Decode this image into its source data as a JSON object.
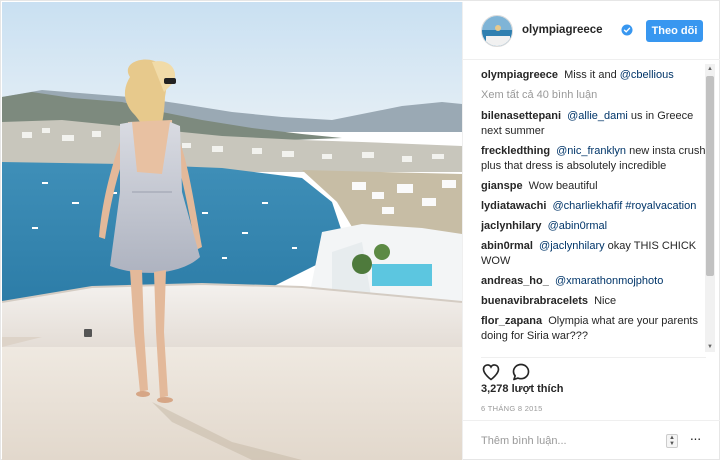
{
  "post": {
    "username": "olympiagreece",
    "follow_label": "Theo dõi",
    "view_all_label": "Xem tất cả 40 bình luận",
    "comments": [
      {
        "user": "olympiagreece",
        "text": "Miss it and ",
        "mention": "@cbellious",
        "after": ""
      },
      {
        "user": "bilenasettepani",
        "text": "",
        "mention": "@allie_dami",
        "after": " us in Greece next summer"
      },
      {
        "user": "freckledthing",
        "text": "",
        "mention": "@nic_franklyn",
        "after": " new insta crush plus that dress is absolutely incredible"
      },
      {
        "user": "gianspe",
        "text": "Wow beautiful",
        "mention": "",
        "after": ""
      },
      {
        "user": "lydiatawachi",
        "text": "",
        "mention": "@charliekhafif #royalvacation",
        "after": ""
      },
      {
        "user": "jaclynhilary",
        "text": "",
        "mention": "@abin0rmal",
        "after": ""
      },
      {
        "user": "abin0rmal",
        "text": "",
        "mention": "@jaclynhilary",
        "after": " okay THIS CHICK WOW"
      },
      {
        "user": "andreas_ho_",
        "text": "",
        "mention": "@xmarathonmojphoto",
        "after": ""
      },
      {
        "user": "buenavibrabracelets",
        "text": "Nice",
        "mention": "",
        "after": ""
      },
      {
        "user": "flor_zapana",
        "text": "Olympia what are your parents doing for Siria war???",
        "mention": "",
        "after": ""
      }
    ],
    "likes": "3,278 lượt thích",
    "date": "6 THÁNG 8 2015",
    "comment_placeholder": "Thêm bình luận...",
    "icons": {
      "like": "heart-icon",
      "comment": "comment-bubble-icon",
      "verified": "verified-badge-icon",
      "more": "more-options-icon"
    },
    "colors": {
      "accent": "#3897f0",
      "mention": "#003569",
      "muted": "#999999"
    }
  }
}
